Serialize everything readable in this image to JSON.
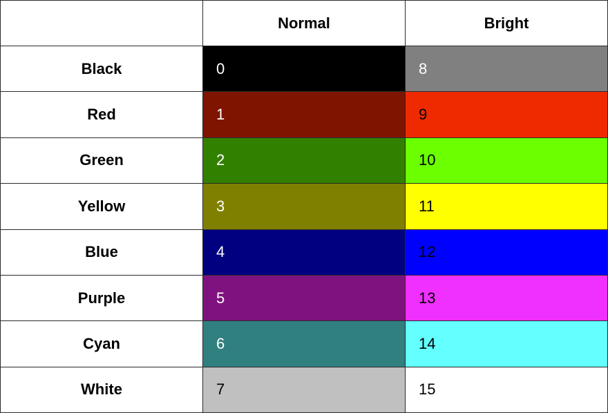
{
  "header": {
    "corner": "",
    "normal": "Normal",
    "bright": "Bright"
  },
  "rows": [
    {
      "name": "Black",
      "normal": {
        "index": "0",
        "bg": "#000000",
        "fg": "#ffffff"
      },
      "bright": {
        "index": "8",
        "bg": "#808080",
        "fg": "#ffffff"
      }
    },
    {
      "name": "Red",
      "normal": {
        "index": "1",
        "bg": "#7f1400",
        "fg": "#ffffff"
      },
      "bright": {
        "index": "9",
        "bg": "#f02a00",
        "fg": "#000000"
      }
    },
    {
      "name": "Green",
      "normal": {
        "index": "2",
        "bg": "#328000",
        "fg": "#ffffff"
      },
      "bright": {
        "index": "10",
        "bg": "#6bff00",
        "fg": "#000000"
      }
    },
    {
      "name": "Yellow",
      "normal": {
        "index": "3",
        "bg": "#808000",
        "fg": "#ffffff"
      },
      "bright": {
        "index": "11",
        "bg": "#ffff00",
        "fg": "#000000"
      }
    },
    {
      "name": "Blue",
      "normal": {
        "index": "4",
        "bg": "#000080",
        "fg": "#ffffff"
      },
      "bright": {
        "index": "12",
        "bg": "#0000ff",
        "fg": "#000000"
      }
    },
    {
      "name": "Purple",
      "normal": {
        "index": "5",
        "bg": "#80127f",
        "fg": "#ffffff"
      },
      "bright": {
        "index": "13",
        "bg": "#f030ff",
        "fg": "#000000"
      }
    },
    {
      "name": "Cyan",
      "normal": {
        "index": "6",
        "bg": "#308080",
        "fg": "#ffffff"
      },
      "bright": {
        "index": "14",
        "bg": "#64ffff",
        "fg": "#000000"
      }
    },
    {
      "name": "White",
      "normal": {
        "index": "7",
        "bg": "#c0c0c0",
        "fg": "#000000"
      },
      "bright": {
        "index": "15",
        "bg": "#ffffff",
        "fg": "#000000"
      }
    }
  ]
}
